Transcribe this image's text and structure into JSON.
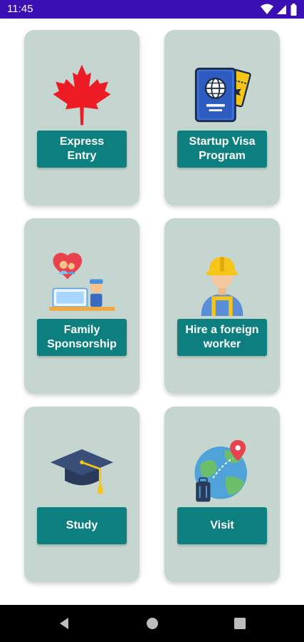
{
  "status": {
    "time": "11:45"
  },
  "cards": [
    {
      "label": "Express\nEntry",
      "icon": "maple-leaf-icon"
    },
    {
      "label": "Startup Visa\nProgram",
      "icon": "passport-ticket-icon"
    },
    {
      "label": "Family\nSponsorship",
      "icon": "family-sponsorship-icon"
    },
    {
      "label": "Hire a foreign\nworker",
      "icon": "construction-worker-icon"
    },
    {
      "label": "Study",
      "icon": "graduation-cap-icon"
    },
    {
      "label": "Visit",
      "icon": "globe-travel-icon"
    }
  ],
  "colors": {
    "status_bar": "#3a0fb3",
    "card_bg": "#c5d5cf",
    "button_bg": "#0c7f7e",
    "nav_bar": "#000000"
  }
}
